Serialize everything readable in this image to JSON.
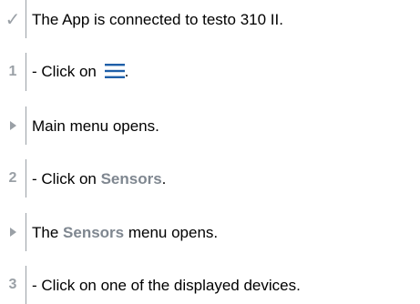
{
  "steps": [
    {
      "marker": "✓",
      "text": "The App is connected to testo 310 II."
    },
    {
      "marker": "1",
      "prefix": "- Click on",
      "icon": "hamburger-menu-icon",
      "suffix": "."
    },
    {
      "marker": "arrow",
      "text": "Main menu opens."
    },
    {
      "marker": "2",
      "prefix": "- Click on ",
      "keyword": "Sensors",
      "suffix": "."
    },
    {
      "marker": "arrow",
      "prefix": "The ",
      "keyword": "Sensors",
      "suffix": " menu opens."
    },
    {
      "marker": "3",
      "text": "- Click on one of the displayed devices."
    }
  ],
  "colors": {
    "marker": "#9aa0a6",
    "keyword": "#7f8790",
    "icon": "#1f5fa8"
  }
}
